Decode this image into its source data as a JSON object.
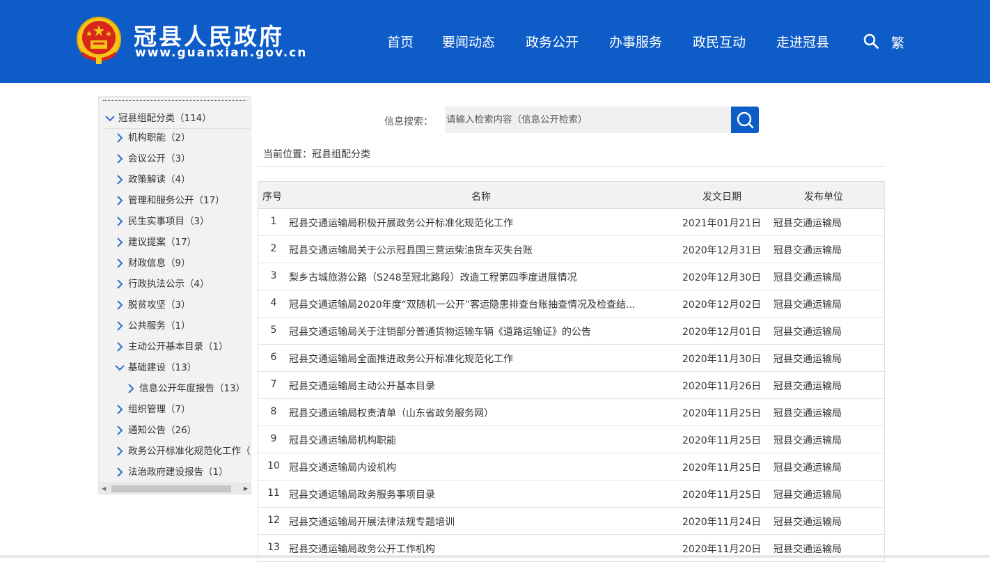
{
  "header": {
    "title": "冠县人民政府",
    "url": "www.guanxian.gov.cn",
    "nav": [
      "首页",
      "要闻动态",
      "政务公开",
      "办事服务",
      "政民互动",
      "走进冠县"
    ],
    "lang_toggle": "繁",
    "brand_color": "#0d5cc7"
  },
  "sidebar": {
    "root": "冠县组配分类（114）",
    "items": [
      "机构职能（2）",
      "会议公开（3）",
      "政策解读（4）",
      "管理和服务公开（17）",
      "民生实事项目（3）",
      "建议提案（17）",
      "财政信息（9）",
      "行政执法公示（4）",
      "脱贫攻坚（3）",
      "公共服务（1）",
      "主动公开基本目录（1）",
      "基础建设（13）",
      "信息公开年度报告（13）",
      "组织管理（7）",
      "通知公告（26）",
      "政务公开标准化规范化工作（",
      "法治政府建设报告（1）"
    ]
  },
  "search": {
    "label": "信息搜索：",
    "placeholder": "请输入检索内容（信息公开检索）"
  },
  "breadcrumb": "当前位置：冠县组配分类",
  "table": {
    "headers": [
      "序号",
      "名称",
      "发文日期",
      "发布单位"
    ],
    "rows": [
      {
        "num": "1",
        "title": "冠县交通运输局积极开展政务公开标准化规范化工作",
        "date": "2021年01月21日",
        "unit": "冠县交通运输局"
      },
      {
        "num": "2",
        "title": "冠县交通运输局关于公示冠县国三营运柴油货车灭失台账",
        "date": "2020年12月31日",
        "unit": "冠县交通运输局"
      },
      {
        "num": "3",
        "title": "梨乡古城旅游公路（S248至冠北路段）改造工程第四季度进展情况",
        "date": "2020年12月30日",
        "unit": "冠县交通运输局"
      },
      {
        "num": "4",
        "title": "冠县交通运输局2020年度“双随机一公开”客运隐患排查台账抽查情况及检查结...",
        "date": "2020年12月02日",
        "unit": "冠县交通运输局"
      },
      {
        "num": "5",
        "title": "冠县交通运输局关于注销部分普通货物运输车辆《道路运输证》的公告",
        "date": "2020年12月01日",
        "unit": "冠县交通运输局"
      },
      {
        "num": "6",
        "title": "冠县交通运输局全面推进政务公开标准化规范化工作",
        "date": "2020年11月30日",
        "unit": "冠县交通运输局"
      },
      {
        "num": "7",
        "title": "冠县交通运输局主动公开基本目录",
        "date": "2020年11月26日",
        "unit": "冠县交通运输局"
      },
      {
        "num": "8",
        "title": "冠县交通运输局权责清单（山东省政务服务网）",
        "date": "2020年11月25日",
        "unit": "冠县交通运输局"
      },
      {
        "num": "9",
        "title": "冠县交通运输局机构职能",
        "date": "2020年11月25日",
        "unit": "冠县交通运输局"
      },
      {
        "num": "10",
        "title": "冠县交通运输局内设机构",
        "date": "2020年11月25日",
        "unit": "冠县交通运输局"
      },
      {
        "num": "11",
        "title": "冠县交通运输局政务服务事项目录",
        "date": "2020年11月25日",
        "unit": "冠县交通运输局"
      },
      {
        "num": "12",
        "title": "冠县交通运输局开展法律法规专题培训",
        "date": "2020年11月24日",
        "unit": "冠县交通运输局"
      },
      {
        "num": "13",
        "title": "冠县交通运输局政务公开工作机构",
        "date": "2020年11月20日",
        "unit": "冠县交通运输局"
      }
    ]
  }
}
